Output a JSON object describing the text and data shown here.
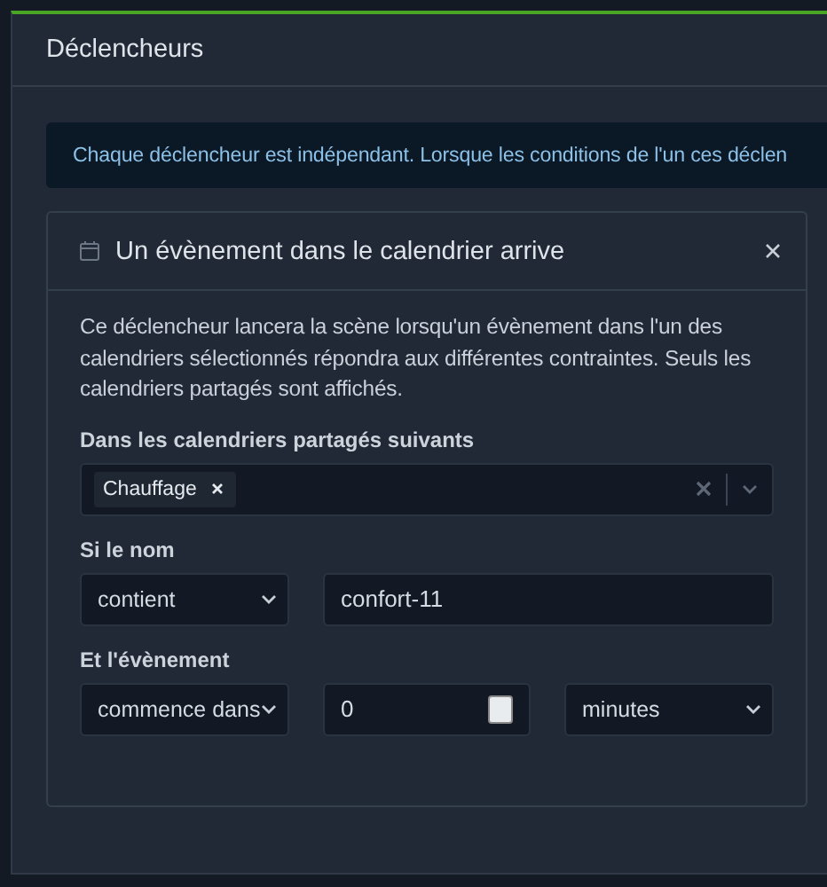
{
  "panel": {
    "title": "Déclencheurs"
  },
  "alert": {
    "text": "Chaque déclencheur est indépendant. Lorsque les conditions de l'un ces déclen"
  },
  "trigger": {
    "title": "Un évènement dans le calendrier arrive",
    "description": "Ce déclencheur lancera la scène lorsqu'un évènement dans l'un des calendriers sélectionnés répondra aux différentes contraintes. Seuls les calendriers partagés sont affichés.",
    "calendars": {
      "label": "Dans les calendriers partagés suivants",
      "tags": [
        "Chauffage"
      ]
    },
    "name": {
      "label": "Si le nom",
      "operator": "contient",
      "value": "confort-11"
    },
    "event": {
      "label": "Et l'évènement",
      "condition": "commence dans",
      "amount": "0",
      "unit": "minutes"
    }
  }
}
